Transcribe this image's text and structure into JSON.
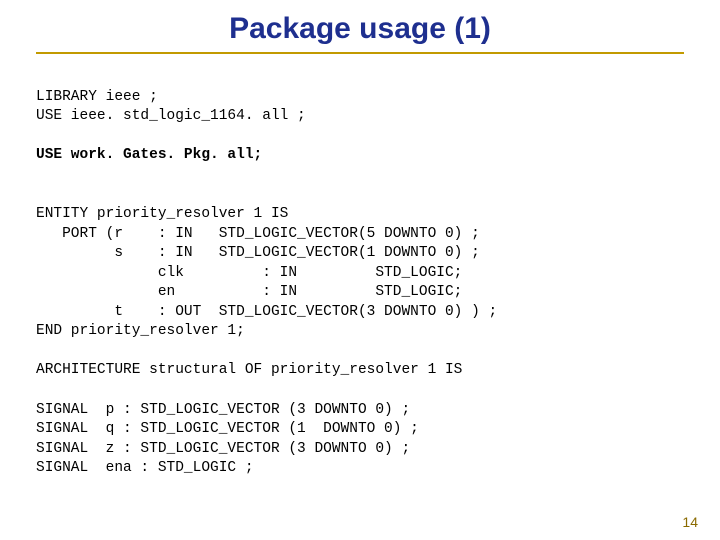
{
  "title": "Package usage (1)",
  "page_number": "14",
  "code": {
    "l1": "LIBRARY ieee ;",
    "l2": "USE ieee. std_logic_1164. all ;",
    "l3": "USE work. Gates. Pkg. all;",
    "l4": "ENTITY priority_resolver 1 IS",
    "l5": "   PORT (r    : IN   STD_LOGIC_VECTOR(5 DOWNTO 0) ;",
    "l6": "         s    : IN   STD_LOGIC_VECTOR(1 DOWNTO 0) ;",
    "l7": "              clk         : IN         STD_LOGIC;",
    "l8": "              en          : IN         STD_LOGIC;",
    "l9": "         t    : OUT  STD_LOGIC_VECTOR(3 DOWNTO 0) ) ;",
    "l10": "END priority_resolver 1;",
    "l11": "ARCHITECTURE structural OF priority_resolver 1 IS",
    "l12": "SIGNAL  p : STD_LOGIC_VECTOR (3 DOWNTO 0) ;",
    "l13": "SIGNAL  q : STD_LOGIC_VECTOR (1  DOWNTO 0) ;",
    "l14": "SIGNAL  z : STD_LOGIC_VECTOR (3 DOWNTO 0) ;",
    "l15": "SIGNAL  ena : STD_LOGIC ;"
  }
}
